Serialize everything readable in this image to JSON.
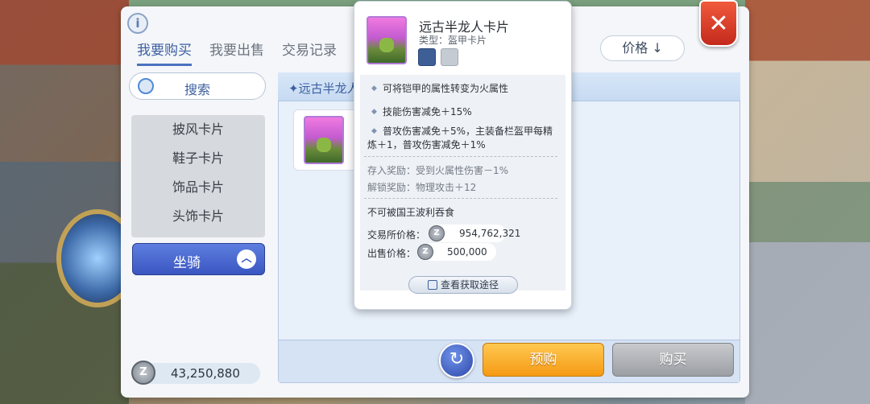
{
  "tabs": [
    "我要购买",
    "我要出售",
    "交易记录"
  ],
  "sort": {
    "label": "价格 ↓"
  },
  "close": {
    "label": "✕"
  },
  "info": {
    "label": "i"
  },
  "search": {
    "label": "搜索"
  },
  "categories": [
    "披风卡片",
    "鞋子卡片",
    "饰品卡片",
    "头饰卡片"
  ],
  "mount": {
    "label": "坐骑",
    "chevron": "︿"
  },
  "wallet": {
    "coin": "Z",
    "amount": "43,250,880"
  },
  "panel": {
    "title": "✦远古半龙人"
  },
  "buttons": {
    "refresh": "↻",
    "preorder": "预购",
    "buy": "购买"
  },
  "tooltip": {
    "name": "远古半龙人卡片",
    "type": "类型：盔甲卡片",
    "effects": [
      "可将铠甲的属性转变为火属性",
      "技能伤害减免＋15%",
      "普攻伤害减免＋5%，主装备栏盔甲每精",
      "炼＋1，普攻伤害减免＋1%"
    ],
    "deposit_bonus": "存入奖励：受到火属性伤害－1%",
    "unlock_bonus": "解锁奖励：物理攻击＋12",
    "note": "不可被国王波利吞食",
    "exchange_label": "交易所价格：",
    "exchange_price": "954,762,321",
    "sell_label": "出售价格：",
    "sell_price": "500,000",
    "coin": "Z",
    "source_btn": "查看获取途径"
  },
  "icons": [
    "info-icon",
    "close-icon",
    "search-icon",
    "chevron-up-icon",
    "zeny-coin-icon",
    "refresh-icon",
    "source-icon"
  ]
}
